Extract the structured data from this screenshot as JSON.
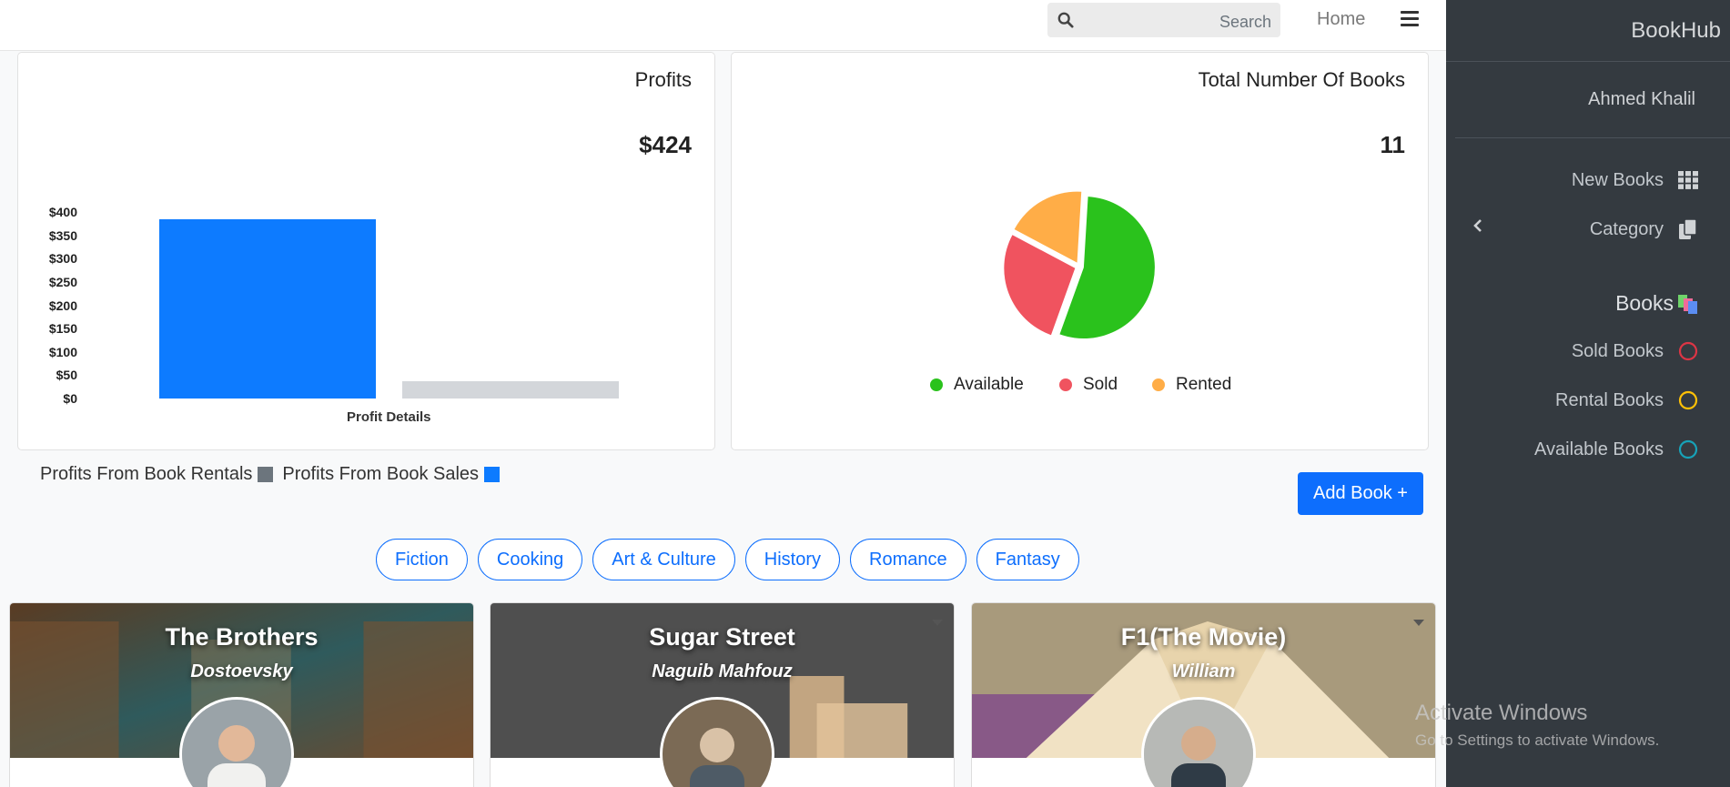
{
  "header": {
    "search_placeholder": "Search",
    "home_label": "Home"
  },
  "profits_card": {
    "title": "Profits",
    "total": "$424",
    "y_ticks": [
      "$400",
      "$350",
      "$300",
      "$250",
      "$200",
      "$150",
      "$100",
      "$50",
      "$0"
    ],
    "x_title": "Profit Details"
  },
  "books_card": {
    "title": "Total Number Of Books",
    "total": "11",
    "legend": [
      "Available",
      "Sold",
      "Rented"
    ]
  },
  "chart_data": [
    {
      "type": "bar",
      "categories": [
        "Profits From Book Sales",
        "Profits From Book Rentals"
      ],
      "values": [
        385,
        38
      ],
      "colors": [
        "#0d7bff",
        "#d3d6da"
      ],
      "title": "Profits",
      "xlabel": "Profit Details",
      "ylabel": "",
      "ylim": [
        0,
        400
      ],
      "grid": false
    },
    {
      "type": "pie",
      "categories": [
        "Available",
        "Sold",
        "Rented"
      ],
      "values": [
        6,
        3,
        2
      ],
      "colors": [
        "#2ac21c",
        "#f0535f",
        "#ffad47"
      ],
      "title": "Total Number Of Books",
      "legend_placement": "bottom"
    }
  ],
  "profit_legend": {
    "rentals_label": "Profits From Book Rentals",
    "sales_label": "Profits From Book Sales",
    "rentals_color": "#6c757d",
    "sales_color": "#0d7bff"
  },
  "add_book_label": "Add Book +",
  "categories": [
    "Fiction",
    "Cooking",
    "Art & Culture",
    "History",
    "Romance",
    "Fantasy"
  ],
  "books": [
    {
      "title": "The Brothers",
      "author": "Dostoevsky"
    },
    {
      "title": "Sugar Street",
      "author": "Naguib Mahfouz"
    },
    {
      "title": "F1(The Movie)",
      "author": "William"
    }
  ],
  "sidebar": {
    "brand": "BookHub",
    "user": "Ahmed Khalil",
    "items": [
      {
        "label": "New Books",
        "icon": "grid-icon"
      },
      {
        "label": "Category",
        "icon": "copy-icon"
      },
      {
        "label": "Books",
        "icon": "books-icon"
      },
      {
        "label": "Sold Books",
        "icon": "circle-red-icon",
        "color": "#dc3545"
      },
      {
        "label": "Rental Books",
        "icon": "circle-yellow-icon",
        "color": "#ffc107"
      },
      {
        "label": "Available Books",
        "icon": "circle-blue-icon",
        "color": "#17a2b8"
      }
    ]
  },
  "watermark": {
    "line1": "Activate Windows",
    "line2": "Go to Settings to activate Windows."
  }
}
